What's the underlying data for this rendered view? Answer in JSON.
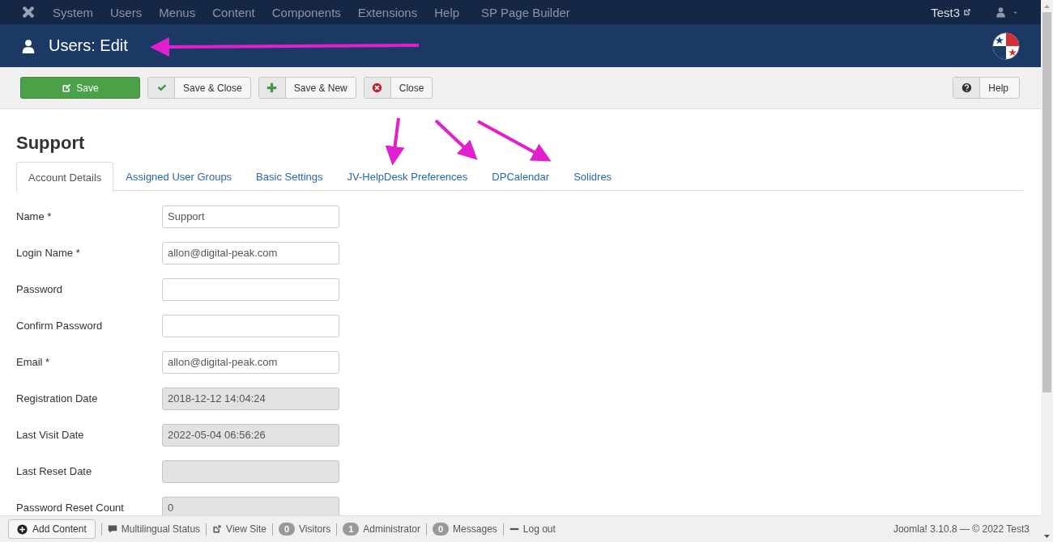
{
  "top_menu": {
    "items": [
      "System",
      "Users",
      "Menus",
      "Content",
      "Components",
      "Extensions",
      "Help",
      "SP Page Builder"
    ],
    "site_link": "Test3"
  },
  "header": {
    "title": "Users: Edit"
  },
  "toolbar": {
    "buttons": [
      {
        "label": "Save",
        "kind": "primary"
      },
      {
        "label": "Save & Close",
        "kind": "default"
      },
      {
        "label": "Save & New",
        "kind": "default"
      },
      {
        "label": "Close",
        "kind": "default"
      }
    ],
    "help": {
      "label": "Help"
    }
  },
  "page_title": "Support",
  "tabs": [
    {
      "label": "Account Details",
      "selected": true
    },
    {
      "label": "Assigned User Groups",
      "selected": false
    },
    {
      "label": "Basic Settings",
      "selected": false
    },
    {
      "label": "JV-HelpDesk Preferences",
      "selected": false
    },
    {
      "label": "DPCalendar",
      "selected": false
    },
    {
      "label": "Solidres",
      "selected": false
    }
  ],
  "fields": [
    {
      "label": "Name *",
      "value": "Support",
      "readonly": false
    },
    {
      "label": "Login Name *",
      "value": "allon@digital-peak.com",
      "readonly": false
    },
    {
      "label": "Password",
      "readonly": false
    },
    {
      "label": "Confirm Password",
      "readonly": false
    },
    {
      "label": "Email *",
      "value": "allon@digital-peak.com",
      "readonly": false
    },
    {
      "label": "Registration Date",
      "value": "2018-12-12 14:04:24",
      "readonly": true
    },
    {
      "label": "Last Visit Date",
      "value": "2022-05-04 06:56:26",
      "readonly": true
    },
    {
      "label": "Last Reset Date",
      "readonly": true
    },
    {
      "label": "Password Reset Count",
      "value": "0",
      "readonly": true
    }
  ],
  "status_bar": {
    "items": [
      {
        "kind": "button",
        "label": "Add Content"
      },
      {
        "kind": "link",
        "label": "Multilingual Status"
      },
      {
        "kind": "link",
        "label": "View Site"
      },
      {
        "kind": "badge",
        "count": "0",
        "label": "Visitors"
      },
      {
        "kind": "badge",
        "count": "1",
        "label": "Administrator"
      },
      {
        "kind": "badge",
        "count": "0",
        "label": "Messages"
      },
      {
        "kind": "link",
        "label": "Log out"
      }
    ],
    "copyright": "Joomla! 3.10.8 — © 2022 Test3"
  }
}
